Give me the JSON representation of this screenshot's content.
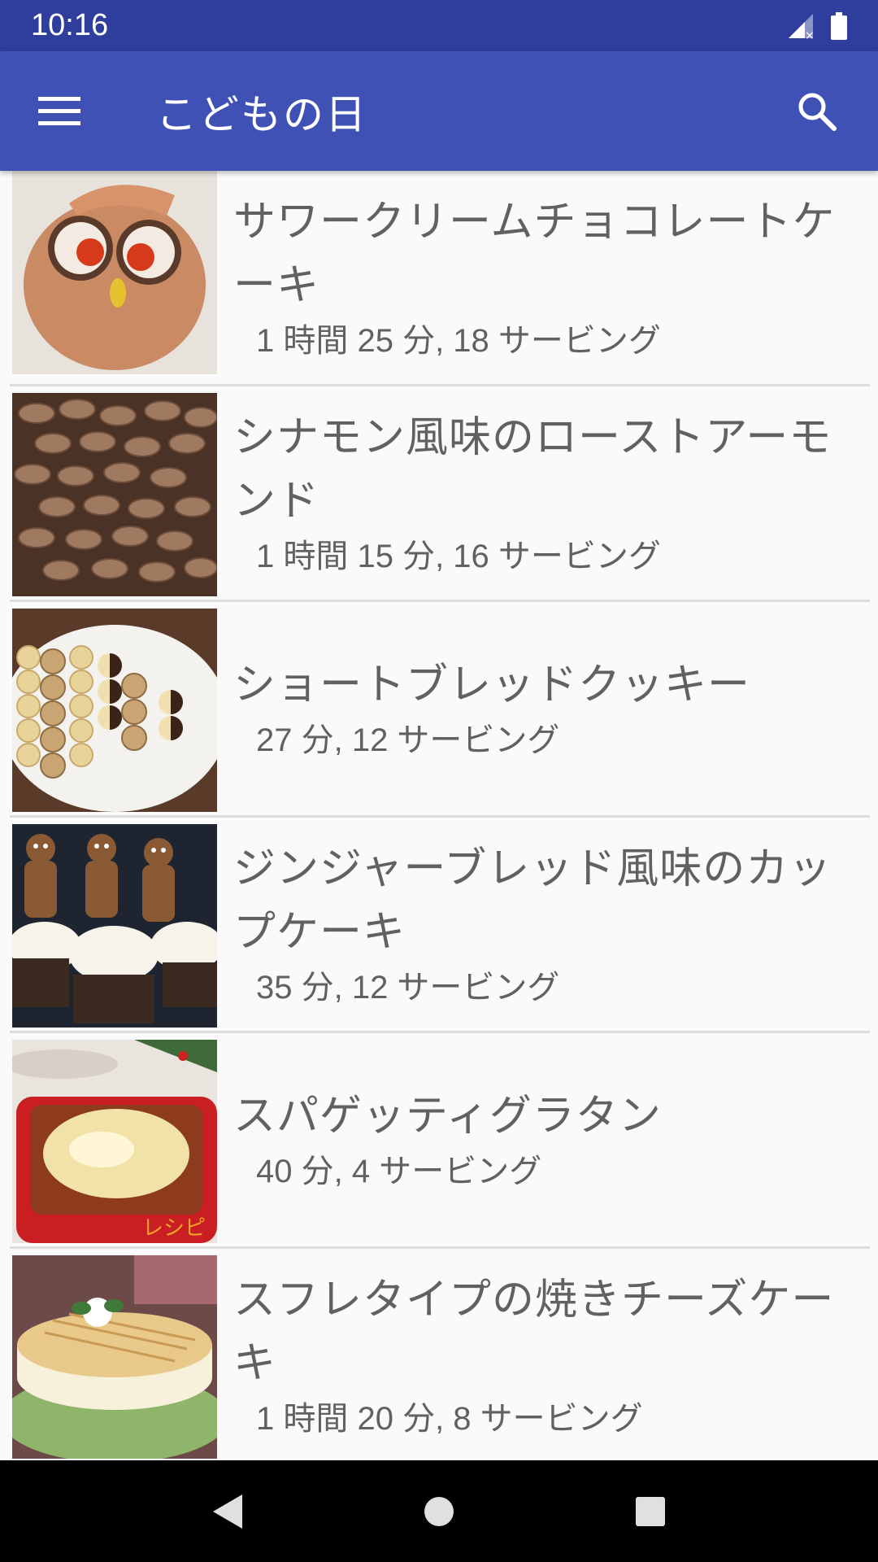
{
  "status_bar": {
    "time": "10:16"
  },
  "app_bar": {
    "title": "こどもの日",
    "menu_icon": "hamburger-menu-icon",
    "search_icon": "search-icon"
  },
  "recipes": [
    {
      "title": "サワークリームチョコレートケーキ",
      "meta": "1 時間 25 分, 18 サービング",
      "image": "owl-cake"
    },
    {
      "title": "シナモン風味のローストアーモンド",
      "meta": "1 時間 15 分, 16 サービング",
      "image": "roasted-almonds"
    },
    {
      "title": "ショートブレッドクッキー",
      "meta": "27 分, 12 サービング",
      "image": "shortbread-cookies"
    },
    {
      "title": "ジンジャーブレッド風味のカップケーキ",
      "meta": "35 分, 12 サービング",
      "image": "gingerbread-cupcakes"
    },
    {
      "title": "スパゲッティグラタン",
      "meta": "40 分, 4 サービング",
      "image": "spaghetti-gratin"
    },
    {
      "title": "スフレタイプの焼きチーズケーキ",
      "meta": "1 時間 20 分, 8 サービング",
      "image": "souffle-cheesecake"
    }
  ],
  "colors": {
    "app_bar": "#3f51b5",
    "status_bar": "#2f3d9c",
    "text": "#616161"
  }
}
